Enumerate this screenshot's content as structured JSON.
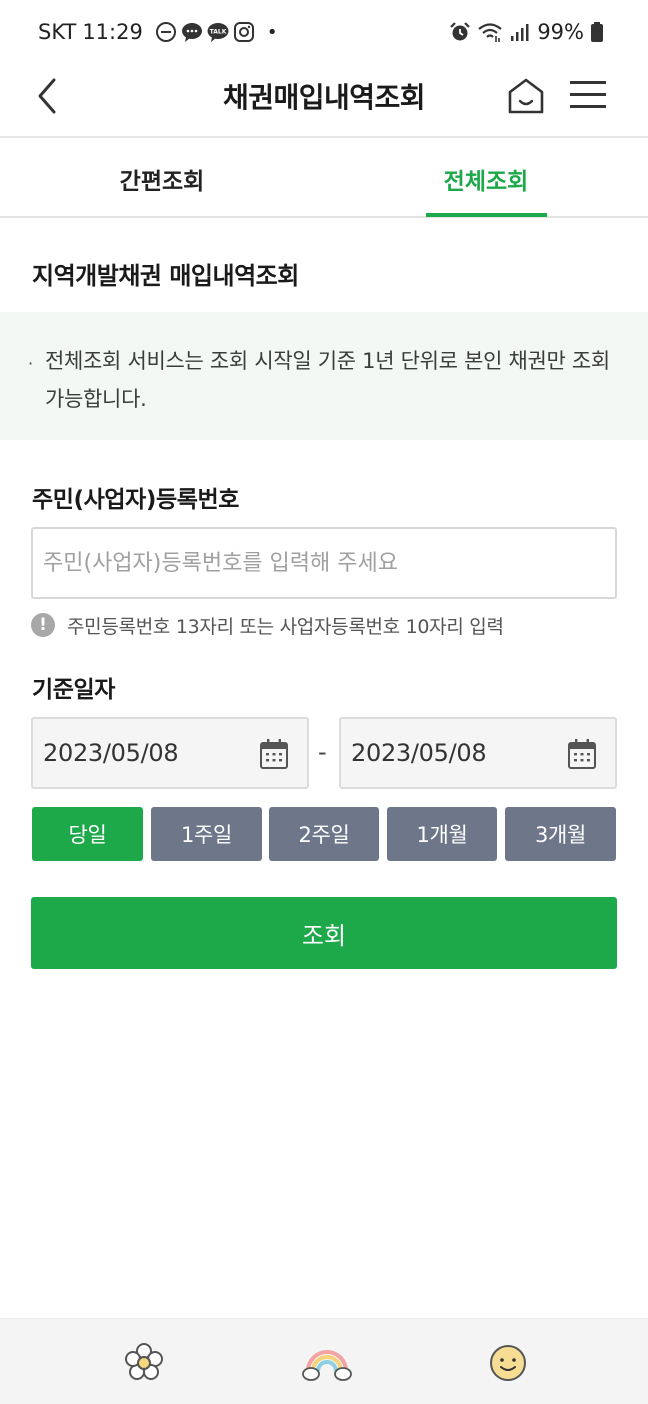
{
  "status_bar": {
    "carrier": "SKT",
    "time": "11:29",
    "battery": "99%",
    "left_icons": [
      "minus-circle-icon",
      "chat-bubble-icon",
      "talk-bubble-icon",
      "instagram-icon",
      "dot-icon"
    ],
    "right_icons": [
      "alarm-icon",
      "wifi-icon",
      "signal-icon",
      "battery-icon"
    ]
  },
  "header": {
    "title": "채권매입내역조회",
    "back_icon": "chevron-left-icon",
    "home_icon": "home-icon",
    "menu_icon": "hamburger-menu-icon"
  },
  "tabs": [
    {
      "label": "간편조회",
      "active": false
    },
    {
      "label": "전체조회",
      "active": true
    }
  ],
  "section": {
    "title": "지역개발채권 매입내역조회"
  },
  "notice": {
    "bullet": "·",
    "text": "전체조회 서비스는 조회 시작일 기준 1년 단위로 본인 채권만 조회 가능합니다."
  },
  "id_field": {
    "label": "주민(사업자)등록번호",
    "value": "",
    "placeholder": "주민(사업자)등록번호를 입력해 주세요",
    "hint": "주민등록번호 13자리 또는 사업자등록번호 10자리 입력",
    "hint_icon": "exclamation-circle-icon"
  },
  "date_field": {
    "label": "기준일자",
    "start": "2023/05/08",
    "end": "2023/05/08",
    "separator": "-",
    "calendar_icon": "calendar-icon"
  },
  "period_buttons": [
    {
      "label": "당일",
      "active": true
    },
    {
      "label": "1주일",
      "active": false
    },
    {
      "label": "2주일",
      "active": false
    },
    {
      "label": "1개월",
      "active": false
    },
    {
      "label": "3개월",
      "active": false
    }
  ],
  "submit": {
    "label": "조회"
  },
  "bottom_bar": {
    "icons": [
      "flower-icon",
      "rainbow-icon",
      "smiley-face-icon"
    ]
  },
  "colors": {
    "accent_green": "#1da84a",
    "period_inactive": "#6d7789",
    "notice_bg": "#f3f8f4",
    "date_bg": "#f5f5f5",
    "bottom_bar_bg": "#f4f4f4"
  }
}
